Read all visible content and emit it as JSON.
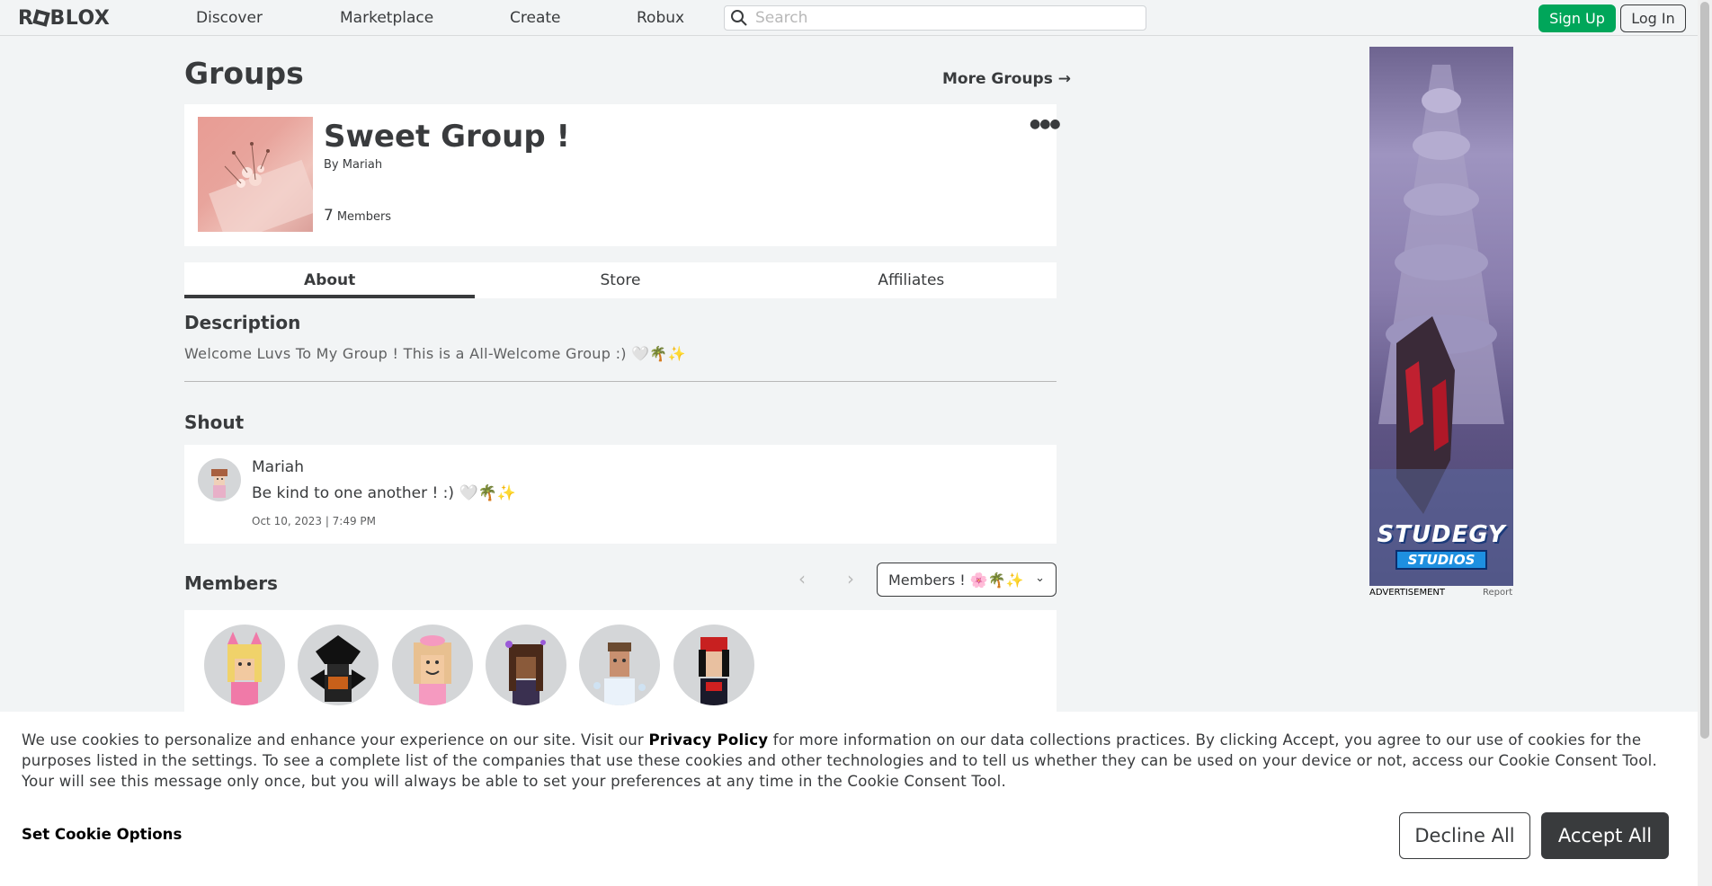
{
  "nav": {
    "logo": "ROBLOX",
    "links": [
      "Discover",
      "Marketplace",
      "Create",
      "Robux"
    ],
    "search_placeholder": "Search",
    "signup": "Sign Up",
    "login": "Log In"
  },
  "page": {
    "title": "Groups",
    "more_groups": "More Groups →"
  },
  "group": {
    "name": "Sweet Group !",
    "by_prefix": "By",
    "owner": "Mariah",
    "member_count": "7",
    "members_label": "Members",
    "more_icon": "ellipsis-icon"
  },
  "tabs": [
    "About",
    "Store",
    "Affiliates"
  ],
  "description": {
    "heading": "Description",
    "text": "Welcome Luvs To My Group ! This is a All-Welcome Group :) 🤍🌴✨"
  },
  "shout": {
    "heading": "Shout",
    "author": "Mariah",
    "body": "Be kind to one another ! :) 🤍🌴✨",
    "date": "Oct 10, 2023 | 7:49 PM"
  },
  "members": {
    "heading": "Members",
    "role_selected": "Members ! 🌸🌴✨",
    "prev_icon": "chevron-left-icon",
    "next_icon": "chevron-right-icon"
  },
  "ad": {
    "brand_top": "STUDEGY",
    "brand_bottom": "STUDIOS",
    "label": "ADVERTISEMENT",
    "report": "Report"
  },
  "cookie": {
    "text_before": "We use cookies to personalize and enhance your experience on our site. Visit our ",
    "link": "Privacy Policy",
    "text_after": " for more information on our data collections practices. By clicking Accept, you agree to our use of cookies for the purposes listed in the settings. To see a complete list of the companies that use these cookies and other technologies and to tell us whether they can be used on your device or not, access our Cookie Consent Tool. Your will see this message only once, but you will always be able to set your preferences at any time in the Cookie Consent Tool.",
    "options": "Set Cookie Options",
    "decline": "Decline All",
    "accept": "Accept All"
  }
}
